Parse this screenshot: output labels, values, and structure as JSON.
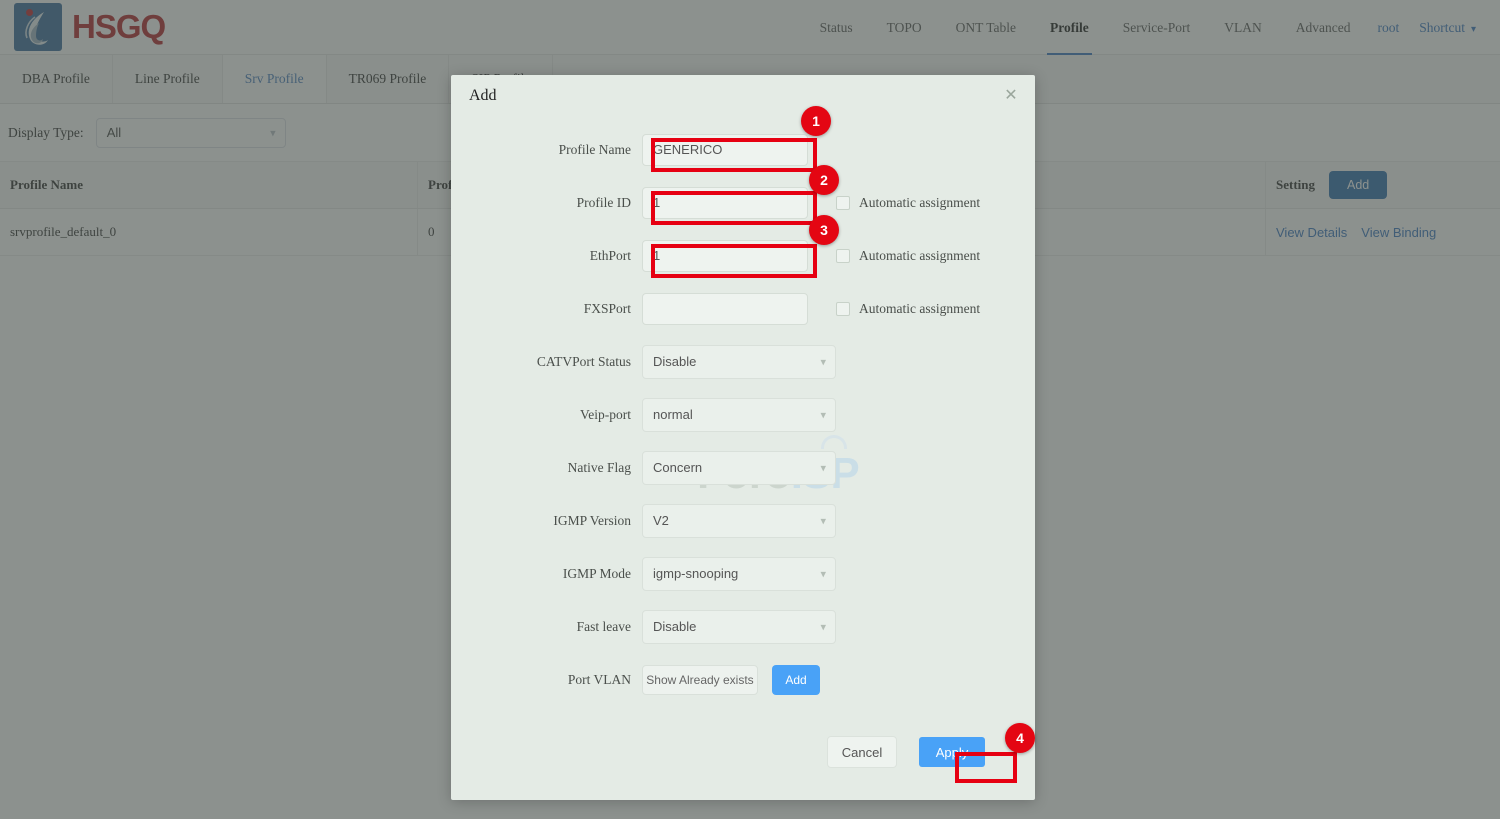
{
  "app": {
    "brand": "HSGQ",
    "logo_icon": "hsgq-droplet-logo"
  },
  "topnav": {
    "items": [
      {
        "label": "Status",
        "active": false
      },
      {
        "label": "TOPO",
        "active": false
      },
      {
        "label": "ONT Table",
        "active": false
      },
      {
        "label": "Profile",
        "active": true
      },
      {
        "label": "Service-Port",
        "active": false
      },
      {
        "label": "VLAN",
        "active": false
      },
      {
        "label": "Advanced",
        "active": false
      }
    ],
    "user": "root",
    "shortcut": "Shortcut"
  },
  "subtabs": {
    "items": [
      {
        "label": "DBA Profile",
        "active": false
      },
      {
        "label": "Line Profile",
        "active": false
      },
      {
        "label": "Srv Profile",
        "active": true
      },
      {
        "label": "TR069 Profile",
        "active": false
      },
      {
        "label": "SIP Profile",
        "active": false
      }
    ]
  },
  "filter": {
    "label": "Display Type:",
    "value": "All"
  },
  "table": {
    "headers": [
      "Profile Name",
      "Profile ID",
      "Setting"
    ],
    "add_button": "Add",
    "rows": [
      {
        "profile_name": "srvprofile_default_0",
        "profile_id": "0",
        "actions": [
          "View Details",
          "View Binding"
        ]
      }
    ]
  },
  "modal": {
    "title": "Add",
    "close_icon": "close-icon",
    "fields": [
      {
        "label": "Profile Name",
        "type": "input",
        "value": "GENERICO",
        "auto": false
      },
      {
        "label": "Profile ID",
        "type": "input",
        "value": "1",
        "auto": true,
        "auto_label": "Automatic assignment"
      },
      {
        "label": "EthPort",
        "type": "input",
        "value": "1",
        "auto": true,
        "auto_label": "Automatic assignment"
      },
      {
        "label": "FXSPort",
        "type": "input",
        "value": "",
        "auto": true,
        "auto_label": "Automatic assignment"
      },
      {
        "label": "CATVPort Status",
        "type": "select",
        "value": "Disable"
      },
      {
        "label": "Veip-port",
        "type": "select",
        "value": "normal"
      },
      {
        "label": "Native Flag",
        "type": "select",
        "value": "Concern"
      },
      {
        "label": "IGMP Version",
        "type": "select",
        "value": "V2"
      },
      {
        "label": "IGMP Mode",
        "type": "select",
        "value": "igmp-snooping"
      },
      {
        "label": "Fast leave",
        "type": "select",
        "value": "Disable"
      }
    ],
    "port_vlan": {
      "label": "Port VLAN",
      "show_button": "Show Already exists",
      "add_button": "Add"
    },
    "footer": {
      "cancel": "Cancel",
      "apply": "Apply"
    }
  },
  "watermark": {
    "text_a": "Foro",
    "text_b": "ISP"
  },
  "annotations": {
    "badges": [
      "1",
      "2",
      "3",
      "4"
    ],
    "highlight_color": "#e60012"
  },
  "colors": {
    "accent_blue": "#3b78c2",
    "button_blue": "#49a2f7",
    "brand_red": "#b4272c",
    "modal_bg": "#e4ebe5",
    "annotation_red": "#e40613"
  }
}
